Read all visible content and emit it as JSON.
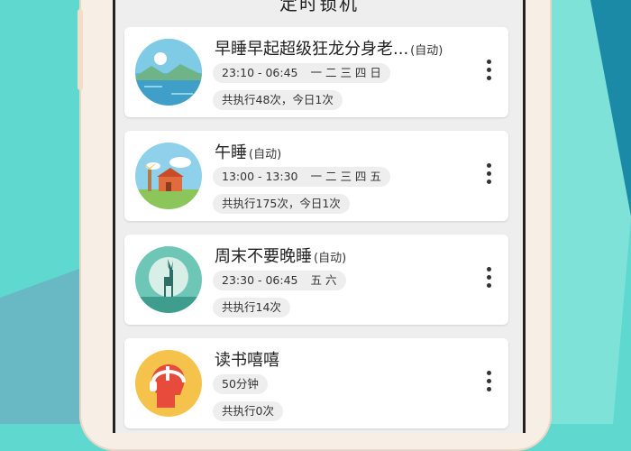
{
  "screen": {
    "title": "定时锁机"
  },
  "tasks": [
    {
      "name": "早睡早起超级狂龙分身老...",
      "auto": "(自动)",
      "time": "23:10 - 06:45",
      "days": "一 二 三 四 日",
      "stats": "共执行48次，今日1次",
      "icon": "lake-landscape-icon"
    },
    {
      "name": "午睡",
      "auto": "(自动)",
      "time": "13:00 - 13:30",
      "days": "一 二 三 四 五",
      "stats": "共执行175次，今日1次",
      "icon": "windmill-house-icon"
    },
    {
      "name": "周末不要晚睡",
      "auto": "(自动)",
      "time": "23:30 - 06:45",
      "days": "五 六",
      "stats": "共执行14次",
      "icon": "deer-moon-icon"
    },
    {
      "name": "读书嘻嘻",
      "auto": "",
      "time": "50分钟",
      "days": "",
      "stats": "共执行0次",
      "icon": "head-headphones-icon"
    }
  ],
  "colors": {
    "background": "#5fd9cf",
    "background_dark": "#1e8fa3",
    "card": "#ffffff",
    "chip": "#eeeeee"
  }
}
